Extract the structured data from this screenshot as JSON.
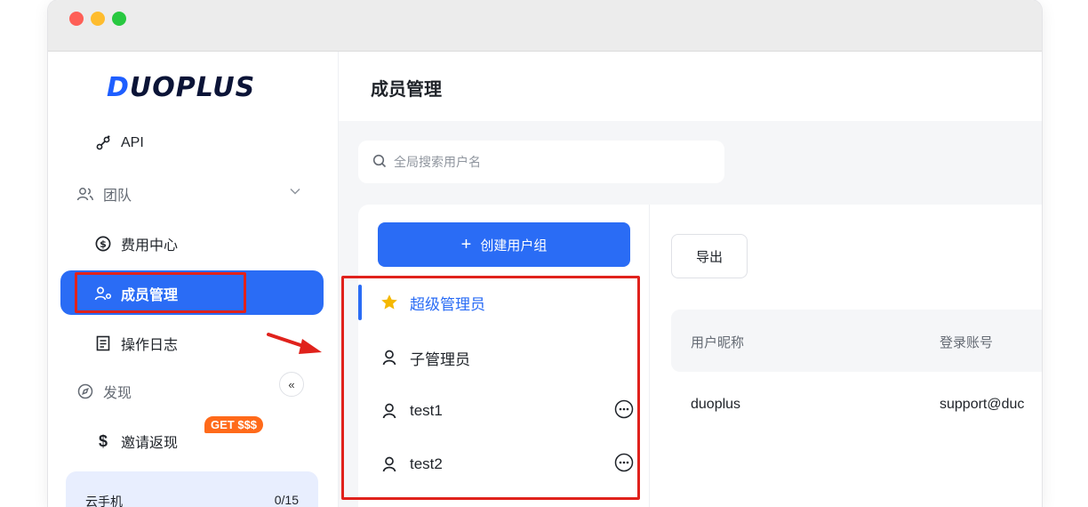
{
  "window": {
    "traffic_lights": [
      "close",
      "minimize",
      "zoom"
    ]
  },
  "sidebar": {
    "logo": {
      "accent_char": "D",
      "rest": "UOPLUS"
    },
    "items": [
      {
        "label": "API",
        "icon": "api-link-icon"
      },
      {
        "label": "团队",
        "icon": "team-icon",
        "group": true
      },
      {
        "label": "费用中心",
        "icon": "dollar-circle-icon"
      },
      {
        "label": "成员管理",
        "icon": "member-icon",
        "active": true
      },
      {
        "label": "操作日志",
        "icon": "log-icon"
      },
      {
        "label": "发现",
        "icon": "compass-icon",
        "group": true
      },
      {
        "label": "邀请返现",
        "icon": "dollar-icon"
      }
    ],
    "invite_badge": "GET $$$",
    "quota": {
      "label": "云手机",
      "value": "0/15"
    },
    "collapse_glyph": "«"
  },
  "header": {
    "title": "成员管理"
  },
  "search": {
    "placeholder": "全局搜索用户名"
  },
  "groups": {
    "create_button": "创建用户组",
    "items": [
      {
        "label": "超级管理员",
        "icon": "star-icon",
        "active": true
      },
      {
        "label": "子管理员",
        "icon": "user-icon"
      },
      {
        "label": "test1",
        "icon": "user-icon",
        "more": true
      },
      {
        "label": "test2",
        "icon": "user-icon",
        "more": true
      }
    ]
  },
  "members": {
    "export_button": "导出",
    "columns": [
      "用户昵称",
      "登录账号"
    ],
    "rows": [
      [
        "duoplus",
        "support@duc"
      ]
    ]
  },
  "colors": {
    "primary": "#2a6cf5",
    "highlight_box": "#e0221c",
    "badge": "#ff6a1a",
    "star": "#f5b800"
  }
}
